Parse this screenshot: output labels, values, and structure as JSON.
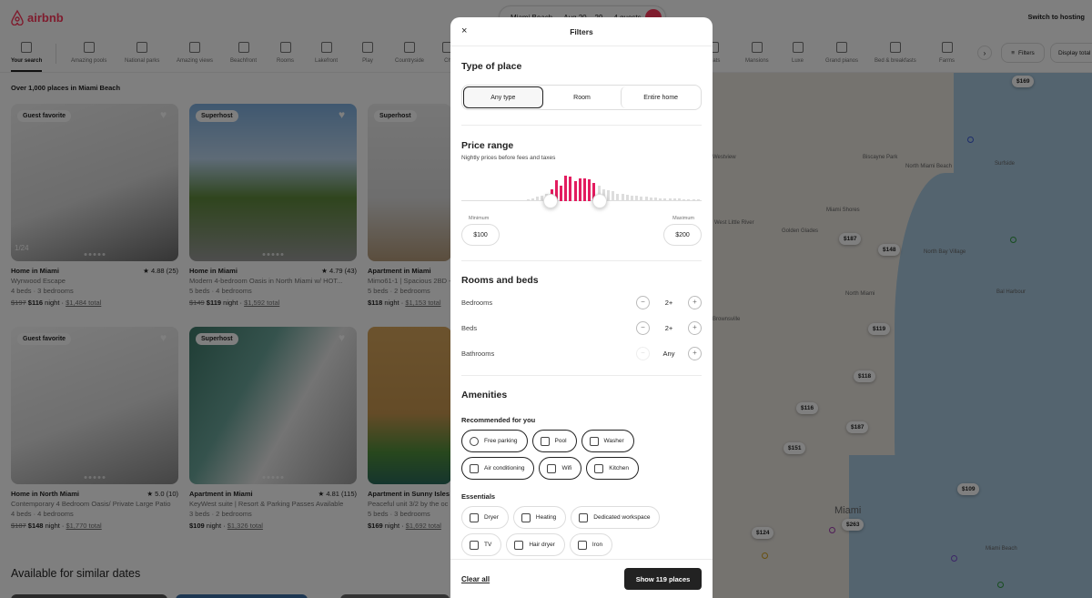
{
  "brand": {
    "name": "airbnb",
    "color": "#ff385c"
  },
  "search": {
    "location": "Miami Beach",
    "dates": "Aug 20 – 29",
    "guests": "4 guests"
  },
  "header": {
    "switch_to_hosting": "Switch to hosting"
  },
  "categories": [
    {
      "label": "Your search",
      "active": true
    },
    {
      "label": "Amazing pools"
    },
    {
      "label": "National parks"
    },
    {
      "label": "Amazing views"
    },
    {
      "label": "Beachfront"
    },
    {
      "label": "Rooms"
    },
    {
      "label": "Lakefront"
    },
    {
      "label": "Play"
    },
    {
      "label": "Countryside"
    },
    {
      "label": "Ch"
    },
    {
      "label": "Boats"
    },
    {
      "label": "Mansions"
    },
    {
      "label": "Luxe"
    },
    {
      "label": "Grand pianos"
    },
    {
      "label": "Bed & breakfasts"
    },
    {
      "label": "Farms"
    }
  ],
  "toolbar": {
    "filters_label": "Filters",
    "display_total_label": "Display total before taxes",
    "next_icon": "›"
  },
  "results": {
    "count_text": "Over 1,000 places in Miami Beach",
    "similar_heading": "Available for similar dates"
  },
  "listings": [
    {
      "badge": "Guest favorite",
      "title": "Home in Miami",
      "rating": "4.88 (25)",
      "name": "Wynwood Escape",
      "beds": "4 beds · 3 bedrooms",
      "old_price": "$197",
      "price": "$116",
      "unit": "night",
      "total": "$1,484 total",
      "photo_counter": "1/24"
    },
    {
      "badge": "Superhost",
      "title": "Home in Miami",
      "rating": "4.79 (43)",
      "name": "Modern 4-bedroom Oasis in North Miami w/ HOT...",
      "beds": "5 beds · 4 bedrooms",
      "old_price": "$149",
      "price": "$119",
      "unit": "night",
      "total": "$1,592 total"
    },
    {
      "badge": "Superhost",
      "title": "Apartment in Miami",
      "rating": "",
      "name": "Mimo61-1 | Spacious 2BD +",
      "beds": "5 beds · 2 bedrooms",
      "old_price": "",
      "price": "$118",
      "unit": "night",
      "total": "$1,153 total"
    },
    {
      "badge": "Guest favorite",
      "title": "Home in North Miami",
      "rating": "5.0 (10)",
      "name": "Contemporary 4 Bedroom Oasis/ Private Large Patio",
      "beds": "4 beds · 4 bedrooms",
      "old_price": "$187",
      "price": "$148",
      "unit": "night",
      "total": "$1,770 total"
    },
    {
      "badge": "Superhost",
      "title": "Apartment in Miami",
      "rating": "4.81 (115)",
      "name": "KeyWest suite | Resort & Parking Passes Available",
      "beds": "3 beds · 2 bedrooms",
      "old_price": "",
      "price": "$109",
      "unit": "night",
      "total": "$1,326 total"
    },
    {
      "badge": "",
      "title": "Apartment in Sunny Isles B",
      "rating": "",
      "name": "Peaceful unit 3/2 by the oc",
      "beds": "5 beds · 3 bedrooms",
      "old_price": "",
      "price": "$169",
      "unit": "night",
      "total": "$1,692 total"
    }
  ],
  "map": {
    "labels": [
      "North Miami Beach",
      "Golden Glades",
      "North Miami",
      "Bal Harbour",
      "Biscayne Park",
      "Surfside",
      "Miami Shores",
      "West Little River",
      "North Bay Village",
      "Brownsville",
      "Miami Beach",
      "Miami",
      "Westview"
    ],
    "pins": [
      "$169",
      "$187",
      "$148",
      "$119",
      "$118",
      "$116",
      "$187",
      "$151",
      "$109",
      "$263",
      "$124"
    ]
  },
  "filters": {
    "title": "Filters",
    "close_icon": "×",
    "type_of_place": {
      "heading": "Type of place",
      "options": [
        "Any type",
        "Room",
        "Entire home"
      ],
      "selected": "Any type"
    },
    "price_range": {
      "heading": "Price range",
      "subtext": "Nightly prices before fees and taxes",
      "min_label": "Minimum",
      "max_label": "Maximum",
      "min_value": "$100",
      "max_value": "$200",
      "selected_color": "#e31c5f",
      "unselected_color": "#dddddd",
      "histogram": [
        0.03,
        0.03,
        0.05,
        0.08,
        0.12,
        0.18,
        0.22,
        0.3,
        0.48,
        0.82,
        0.62,
        1.0,
        0.95,
        0.8,
        0.88,
        0.9,
        0.84,
        0.7,
        0.6,
        0.48,
        0.42,
        0.4,
        0.3,
        0.3,
        0.26,
        0.22,
        0.2,
        0.18,
        0.18,
        0.16,
        0.14,
        0.12,
        0.12,
        0.1,
        0.1,
        0.09,
        0.08,
        0.08,
        0.07,
        0.06
      ],
      "selected_range": [
        8,
        17
      ]
    },
    "rooms_and_beds": {
      "heading": "Rooms and beds",
      "rows": [
        {
          "label": "Bedrooms",
          "value": "2+",
          "minus_enabled": true
        },
        {
          "label": "Beds",
          "value": "2+",
          "minus_enabled": true
        },
        {
          "label": "Bathrooms",
          "value": "Any",
          "minus_enabled": false
        }
      ],
      "minus_icon": "−",
      "plus_icon": "+"
    },
    "amenities": {
      "heading": "Amenities",
      "recommended_heading": "Recommended for you",
      "recommended": [
        {
          "label": "Free parking",
          "icon": "parking-icon"
        },
        {
          "label": "Pool",
          "icon": "pool-icon"
        },
        {
          "label": "Washer",
          "icon": "washer-icon"
        },
        {
          "label": "Air conditioning",
          "icon": "snowflake-icon"
        },
        {
          "label": "Wifi",
          "icon": "wifi-icon"
        },
        {
          "label": "Kitchen",
          "icon": "kitchen-icon"
        }
      ],
      "essentials_heading": "Essentials",
      "essentials": [
        {
          "label": "Dryer",
          "icon": "dryer-icon"
        },
        {
          "label": "Heating",
          "icon": "thermometer-icon"
        },
        {
          "label": "Dedicated workspace",
          "icon": "workspace-icon"
        },
        {
          "label": "TV",
          "icon": "tv-icon"
        },
        {
          "label": "Hair dryer",
          "icon": "hair-dryer-icon"
        },
        {
          "label": "Iron",
          "icon": "iron-icon"
        }
      ]
    },
    "footer": {
      "clear_all": "Clear all",
      "show_button": "Show 119 places"
    }
  }
}
